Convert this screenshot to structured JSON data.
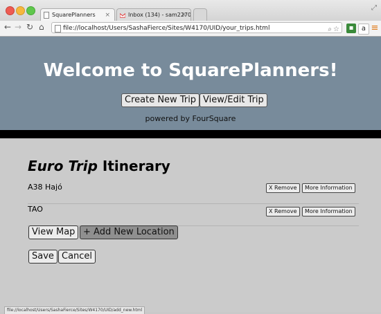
{
  "browser": {
    "tabs": [
      {
        "title": "SquarePlanners"
      },
      {
        "title": "Inbox (134) - sam2270@..."
      }
    ],
    "url": "file://localhost/Users/SashaFierce/Sites/W4170/UID/your_trips.html",
    "status_url": "file://localhost/Users/SashaFierce/Sites/W4170/UID/add_new.html"
  },
  "header": {
    "title": "Welcome to SquarePlanners!",
    "create_trip_label": "Create New Trip",
    "view_edit_label": "View/Edit Trip",
    "powered_by": "powered by FourSquare"
  },
  "itinerary": {
    "trip_name": "Euro Trip",
    "title_suffix": "Itinerary",
    "locations": [
      {
        "name": "A38 Hajó"
      },
      {
        "name": "TAO"
      }
    ],
    "remove_label": "X Remove",
    "more_info_label": "More Information"
  },
  "actions": {
    "view_map_label": "View Map",
    "add_location_label": "+ Add New Location",
    "save_label": "Save",
    "cancel_label": "Cancel"
  },
  "colors": {
    "header_bg": "#788b9b",
    "page_bg": "#cbcbcb",
    "divider": "#000000"
  }
}
